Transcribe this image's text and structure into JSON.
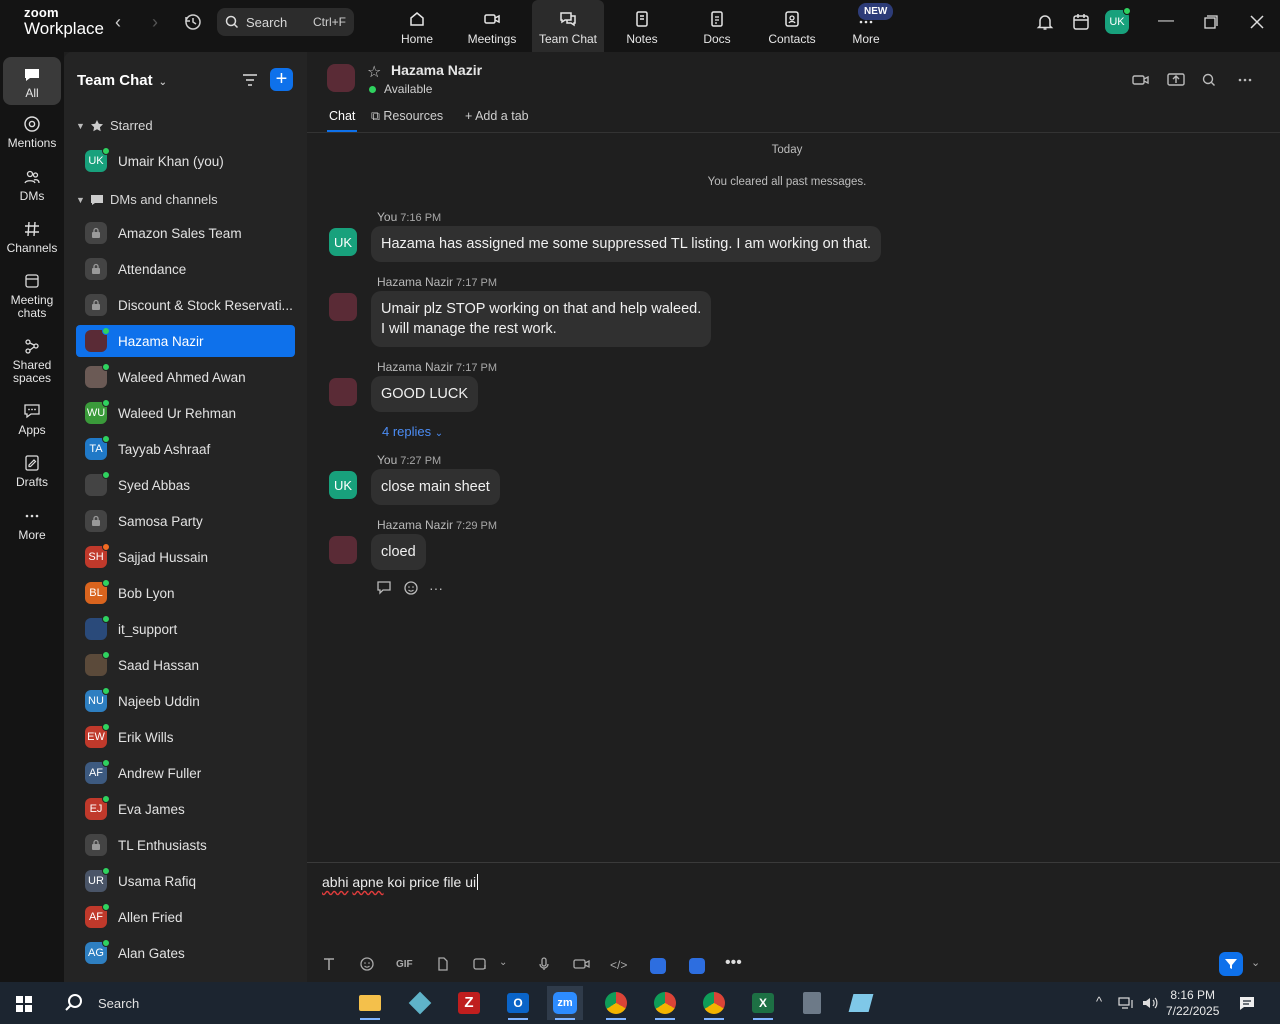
{
  "app": {
    "logo_line1": "zoom",
    "logo_line2": "Workplace"
  },
  "search": {
    "label": "Search",
    "shortcut": "Ctrl+F"
  },
  "nav_tabs": [
    {
      "label": "Home"
    },
    {
      "label": "Meetings"
    },
    {
      "label": "Team Chat"
    },
    {
      "label": "Notes"
    },
    {
      "label": "Docs"
    },
    {
      "label": "Contacts"
    },
    {
      "label": "More"
    }
  ],
  "new_badge": "NEW",
  "user_avatar": "UK",
  "rail": [
    {
      "label": "All"
    },
    {
      "label": "Mentions"
    },
    {
      "label": "DMs"
    },
    {
      "label": "Channels"
    },
    {
      "label": "Meeting chats"
    },
    {
      "label": "Shared spaces"
    },
    {
      "label": "Apps"
    },
    {
      "label": "Drafts"
    },
    {
      "label": "More"
    }
  ],
  "sidebar": {
    "title": "Team Chat",
    "starred_label": "Starred",
    "dms_label": "DMs and channels",
    "starred": [
      {
        "initials": "UK",
        "name": "Umair Khan (you)",
        "color": "#18a17c"
      }
    ],
    "items": [
      {
        "initials": "",
        "name": "Amazon Sales Team",
        "type": "lock"
      },
      {
        "initials": "",
        "name": "Attendance",
        "type": "lock"
      },
      {
        "initials": "",
        "name": "Discount & Stock Reservati...",
        "type": "lock"
      },
      {
        "initials": "",
        "name": "Hazama Nazir",
        "type": "photo",
        "color": "#5a2b36",
        "selected": true
      },
      {
        "initials": "",
        "name": "Waleed Ahmed Awan",
        "type": "photo",
        "color": "#6b5a55"
      },
      {
        "initials": "WU",
        "name": "Waleed Ur Rehman",
        "color": "#3a9a3a"
      },
      {
        "initials": "TA",
        "name": "Tayyab Ashraaf",
        "color": "#2079c7"
      },
      {
        "initials": "",
        "name": "Syed Abbas",
        "type": "photo",
        "color": "#444"
      },
      {
        "initials": "",
        "name": "Samosa Party",
        "type": "lock"
      },
      {
        "initials": "SH",
        "name": "Sajjad Hussain",
        "color": "#c0392b",
        "status": "orange"
      },
      {
        "initials": "BL",
        "name": "Bob Lyon",
        "color": "#d9641e"
      },
      {
        "initials": "",
        "name": "it_support",
        "type": "photo",
        "color": "#2a4a7a"
      },
      {
        "initials": "",
        "name": "Saad Hassan",
        "type": "photo",
        "color": "#5b4a3a"
      },
      {
        "initials": "NU",
        "name": "Najeeb Uddin",
        "color": "#2e7fc1"
      },
      {
        "initials": "EW",
        "name": "Erik Wills",
        "color": "#c0392b"
      },
      {
        "initials": "AF",
        "name": "Andrew Fuller",
        "color": "#3d5a80"
      },
      {
        "initials": "EJ",
        "name": "Eva James",
        "color": "#c0392b"
      },
      {
        "initials": "",
        "name": "TL Enthusiasts",
        "type": "lock"
      },
      {
        "initials": "UR",
        "name": "Usama Rafiq",
        "color": "#4a5568"
      },
      {
        "initials": "AF",
        "name": "Allen Fried",
        "color": "#c0392b"
      },
      {
        "initials": "AG",
        "name": "Alan Gates",
        "color": "#2e7fc1"
      }
    ]
  },
  "chat": {
    "name": "Hazama Nazir",
    "status": "Available",
    "tabs": [
      {
        "label": "Chat"
      },
      {
        "label": "Resources"
      },
      {
        "label": "Add a tab"
      }
    ],
    "date_divider": "Today",
    "system_note": "You cleared all past messages.",
    "messages": [
      {
        "sender": "You",
        "time": "7:16 PM",
        "avatar": "UK",
        "lines": [
          "Hazama has assigned me some suppressed TL listing. I am working on that."
        ]
      },
      {
        "sender": "Hazama Nazir",
        "time": "7:17 PM",
        "avatar": "",
        "lines": [
          "Umair plz STOP working on that and help waleed.",
          "I will manage the rest work."
        ]
      },
      {
        "sender": "Hazama Nazir",
        "time": "7:17 PM",
        "avatar": "",
        "lines": [
          "GOOD LUCK"
        ]
      },
      {
        "sender": "You",
        "time": "7:27 PM",
        "avatar": "UK",
        "lines": [
          "close main sheet"
        ]
      },
      {
        "sender": "Hazama Nazir",
        "time": "7:29 PM",
        "avatar": "",
        "lines": [
          "cloed"
        ]
      }
    ],
    "replies_label": "4 replies",
    "composer": {
      "word1": "abhi",
      "word2": "apne",
      "rest": " koi price file ui"
    }
  },
  "taskbar": {
    "search_label": "Search",
    "time": "8:16 PM",
    "date": "7/22/2025"
  },
  "colors": {
    "accent": "#0e71eb",
    "online": "#2fd25f",
    "bg": "#1f1f1f"
  }
}
